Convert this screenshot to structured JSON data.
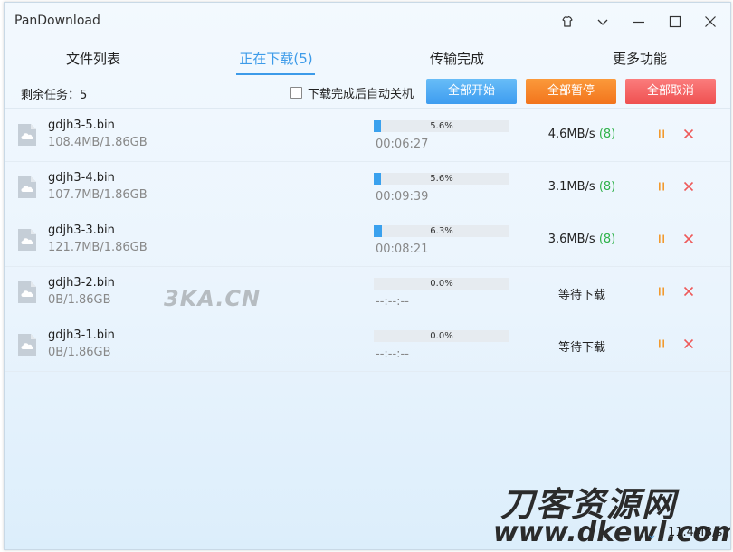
{
  "window": {
    "title": "PanDownload"
  },
  "tabs": [
    {
      "label": "文件列表"
    },
    {
      "label": "正在下载(5)"
    },
    {
      "label": "传输完成"
    },
    {
      "label": "更多功能"
    }
  ],
  "toolbar": {
    "remaining": "剩余任务：5",
    "auto_shutdown_label": "下载完成后自动关机",
    "auto_shutdown_checked": false,
    "start_all": "全部开始",
    "pause_all": "全部暂停",
    "cancel_all": "全部取消"
  },
  "downloads": [
    {
      "name": "gdjh3-5.bin",
      "size": "108.4MB/1.86GB",
      "progress_text": "5.6%",
      "progress": 5.6,
      "eta": "00:06:27",
      "speed": "4.6MB/s",
      "connections": "(8)"
    },
    {
      "name": "gdjh3-4.bin",
      "size": "107.7MB/1.86GB",
      "progress_text": "5.6%",
      "progress": 5.6,
      "eta": "00:09:39",
      "speed": "3.1MB/s",
      "connections": "(8)"
    },
    {
      "name": "gdjh3-3.bin",
      "size": "121.7MB/1.86GB",
      "progress_text": "6.3%",
      "progress": 6.3,
      "eta": "00:08:21",
      "speed": "3.6MB/s",
      "connections": "(8)"
    },
    {
      "name": "gdjh3-2.bin",
      "size": "0B/1.86GB",
      "progress_text": "0.0%",
      "progress": 0,
      "eta": "--:--:--",
      "speed": "等待下载",
      "connections": ""
    },
    {
      "name": "gdjh3-1.bin",
      "size": "0B/1.86GB",
      "progress_text": "0.0%",
      "progress": 0,
      "eta": "--:--:--",
      "speed": "等待下载",
      "connections": ""
    }
  ],
  "watermarks": {
    "center": "3KA.CN",
    "brand": "刀客资源网",
    "url": "www.dkewl.com"
  },
  "status_bar": {
    "total_speed": "11.4MB/s"
  },
  "colors": {
    "accent": "#3d9be9",
    "start": "#4aa8f3",
    "pause": "#f58226",
    "cancel": "#f05c5c",
    "connections": "#2fb24a",
    "progress": "#3aa1ee"
  },
  "icons": [
    "skin-icon",
    "chevron-down-icon",
    "minimize-icon",
    "maximize-icon",
    "close-icon",
    "cloud-file-icon",
    "pause-icon",
    "cancel-icon",
    "download-arrow-icon"
  ]
}
